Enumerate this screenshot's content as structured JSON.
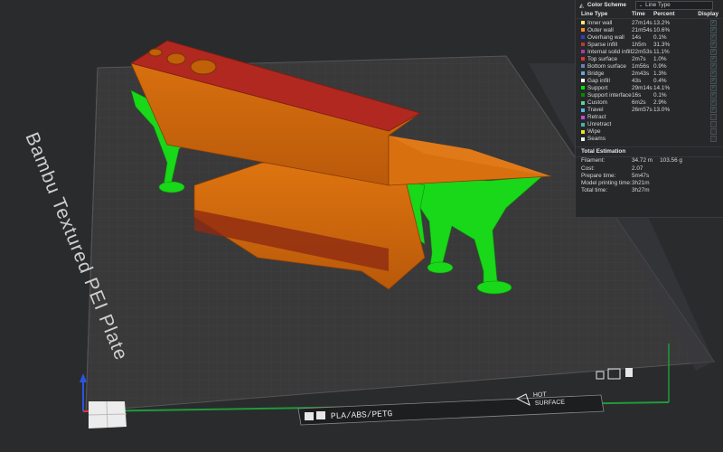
{
  "plate": {
    "label": "Bambu Textured PEI Plate",
    "filament_label": "PLA/ABS/PETG",
    "hot_label": "HOT",
    "surface_label": "SURFACE"
  },
  "panel": {
    "scheme_title": "Color Scheme",
    "scheme_value": "Line Type",
    "headers": {
      "line_type": "Line Type",
      "time": "Time",
      "percent": "Percent",
      "display": "Display"
    },
    "rows": [
      {
        "name": "Inner wall",
        "time": "27m14s",
        "percent": "13.2%",
        "color": "#ffe67a",
        "checked": true
      },
      {
        "name": "Outer wall",
        "time": "21m54s",
        "percent": "10.6%",
        "color": "#ff8a1c",
        "checked": true
      },
      {
        "name": "Overhang wall",
        "time": "14s",
        "percent": "0.1%",
        "color": "#2e3bd6",
        "checked": true
      },
      {
        "name": "Sparse infill",
        "time": "1h5m",
        "percent": "31.3%",
        "color": "#b63a3a",
        "checked": true
      },
      {
        "name": "Internal solid infill",
        "time": "22m53s",
        "percent": "11.1%",
        "color": "#a23db0",
        "checked": true
      },
      {
        "name": "Top surface",
        "time": "2m7s",
        "percent": "1.0%",
        "color": "#e63232",
        "checked": true
      },
      {
        "name": "Bottom surface",
        "time": "1m56s",
        "percent": "0.9%",
        "color": "#6a7fb4",
        "checked": true
      },
      {
        "name": "Bridge",
        "time": "2m43s",
        "percent": "1.3%",
        "color": "#6aa3d8",
        "checked": true
      },
      {
        "name": "Gap infill",
        "time": "43s",
        "percent": "0.4%",
        "color": "#ffffff",
        "checked": true
      },
      {
        "name": "Support",
        "time": "29m14s",
        "percent": "14.1%",
        "color": "#00e600",
        "checked": true
      },
      {
        "name": "Support interface",
        "time": "16s",
        "percent": "0.1%",
        "color": "#008f00",
        "checked": true
      },
      {
        "name": "Custom",
        "time": "6m2s",
        "percent": "2.9%",
        "color": "#5fd39a",
        "checked": true
      },
      {
        "name": "Travel",
        "time": "26m57s",
        "percent": "13.0%",
        "color": "#55b6e6",
        "checked": true
      },
      {
        "name": "Retract",
        "time": "",
        "percent": "",
        "color": "#c64bd6",
        "checked": false
      },
      {
        "name": "Unretract",
        "time": "",
        "percent": "",
        "color": "#3fb6b0",
        "checked": false
      },
      {
        "name": "Wipe",
        "time": "",
        "percent": "",
        "color": "#f2e21a",
        "checked": false
      },
      {
        "name": "Seams",
        "time": "",
        "percent": "",
        "color": "#f0f0f0",
        "checked": false
      }
    ],
    "total_title": "Total Estimation",
    "filament_label": "Filament:",
    "filament_length": "34.72 m",
    "filament_weight": "103.56 g",
    "cost_label": "Cost:",
    "cost_value": "2.07",
    "prepare_label": "Prepare time:",
    "prepare_value": "5m47s",
    "model_label": "Model printing time:",
    "model_value": "3h21m",
    "total_label": "Total time:",
    "total_value": "3h27m"
  },
  "colors": {
    "support": "#19d719",
    "model_orange": "#d36a0a",
    "model_red": "#b0281f",
    "panel_bg": "#26282a",
    "check": "#18b56a"
  }
}
